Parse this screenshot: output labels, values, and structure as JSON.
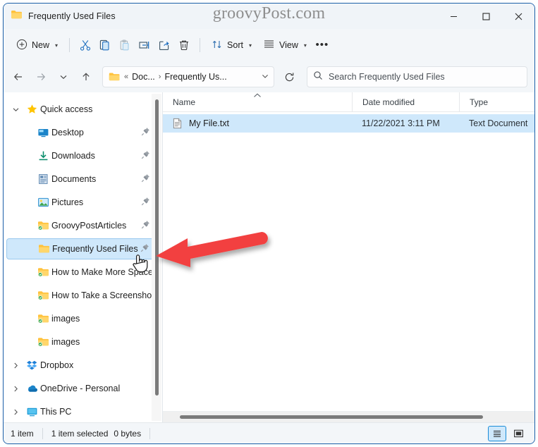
{
  "window": {
    "title": "Frequently Used Files",
    "watermark": "groovyPost.com",
    "controls": {
      "minimize": "—",
      "maximize": "☐",
      "close": "✕"
    }
  },
  "toolbar": {
    "new_label": "New",
    "new_icon": "plus-circle-icon",
    "items": [
      {
        "name": "cut-button",
        "icon": "scissors-icon",
        "label": "Cut"
      },
      {
        "name": "copy-button",
        "icon": "copy-icon",
        "label": "Copy"
      },
      {
        "name": "paste-button",
        "icon": "paste-icon",
        "label": "Paste"
      },
      {
        "name": "rename-button",
        "icon": "rename-icon",
        "label": "Rename"
      },
      {
        "name": "share-button",
        "icon": "share-icon",
        "label": "Share"
      },
      {
        "name": "delete-button",
        "icon": "trash-icon",
        "label": "Delete"
      }
    ],
    "sort_label": "Sort",
    "view_label": "View",
    "more_label": "•••"
  },
  "address": {
    "back_icon": "arrow-left-icon",
    "forward_icon": "arrow-right-icon",
    "recent_icon": "chevron-down-icon",
    "up_icon": "arrow-up-icon",
    "refresh_icon": "refresh-icon",
    "breadcrumb": {
      "folder_icon": "folder-icon",
      "overflow": "«",
      "crumb1": "Doc...",
      "separator": "›",
      "crumb2": "Frequently Us...",
      "dropdown": "⌄"
    }
  },
  "search": {
    "icon": "search-icon",
    "placeholder": "Search Frequently Used Files"
  },
  "sidebar": {
    "items": [
      {
        "label": "Quick access",
        "icon": "star-icon",
        "expander": "chevron-down",
        "indent": false,
        "pinned": false,
        "selected": false
      },
      {
        "label": "Desktop",
        "icon": "desktop-icon",
        "expander": "",
        "indent": true,
        "pinned": true,
        "selected": false
      },
      {
        "label": "Downloads",
        "icon": "downloads-icon",
        "expander": "",
        "indent": true,
        "pinned": true,
        "selected": false
      },
      {
        "label": "Documents",
        "icon": "documents-icon",
        "expander": "",
        "indent": true,
        "pinned": true,
        "selected": false
      },
      {
        "label": "Pictures",
        "icon": "pictures-icon",
        "expander": "",
        "indent": true,
        "pinned": true,
        "selected": false
      },
      {
        "label": "GroovyPostArticles",
        "icon": "folder-sync-icon",
        "expander": "",
        "indent": true,
        "pinned": true,
        "selected": false
      },
      {
        "label": "Frequently Used Files",
        "icon": "folder-icon",
        "expander": "",
        "indent": true,
        "pinned": true,
        "selected": true
      },
      {
        "label": "How to Make More Space Av",
        "icon": "folder-sync-icon",
        "expander": "",
        "indent": true,
        "pinned": false,
        "selected": false
      },
      {
        "label": "How to Take a Screenshot on",
        "icon": "folder-sync-icon",
        "expander": "",
        "indent": true,
        "pinned": false,
        "selected": false
      },
      {
        "label": "images",
        "icon": "folder-sync-icon",
        "expander": "",
        "indent": true,
        "pinned": false,
        "selected": false
      },
      {
        "label": "images",
        "icon": "folder-sync-icon",
        "expander": "",
        "indent": true,
        "pinned": false,
        "selected": false
      },
      {
        "label": "Dropbox",
        "icon": "dropbox-icon",
        "expander": "chevron-right",
        "indent": false,
        "pinned": false,
        "selected": false
      },
      {
        "label": "OneDrive - Personal",
        "icon": "onedrive-icon",
        "expander": "chevron-right",
        "indent": false,
        "pinned": false,
        "selected": false
      },
      {
        "label": "This PC",
        "icon": "pc-icon",
        "expander": "chevron-right",
        "indent": false,
        "pinned": false,
        "selected": false
      }
    ]
  },
  "filelist": {
    "columns": {
      "name": "Name",
      "date": "Date modified",
      "type": "Type"
    },
    "sort_indicator": "⌃",
    "rows": [
      {
        "icon": "text-file-icon",
        "name": "My File.txt",
        "date": "11/22/2021 3:11 PM",
        "type": "Text Document",
        "selected": true
      }
    ]
  },
  "status": {
    "item_count": "1 item",
    "selection": "1 item selected",
    "size": "0 bytes",
    "views": [
      {
        "name": "details-view-toggle",
        "icon": "details-view-icon",
        "active": true
      },
      {
        "name": "large-icons-view-toggle",
        "icon": "large-icons-view-icon",
        "active": false
      }
    ]
  },
  "annotation": {
    "arrow_color": "#F2403F",
    "arrow_name": "red-pointer-arrow"
  }
}
